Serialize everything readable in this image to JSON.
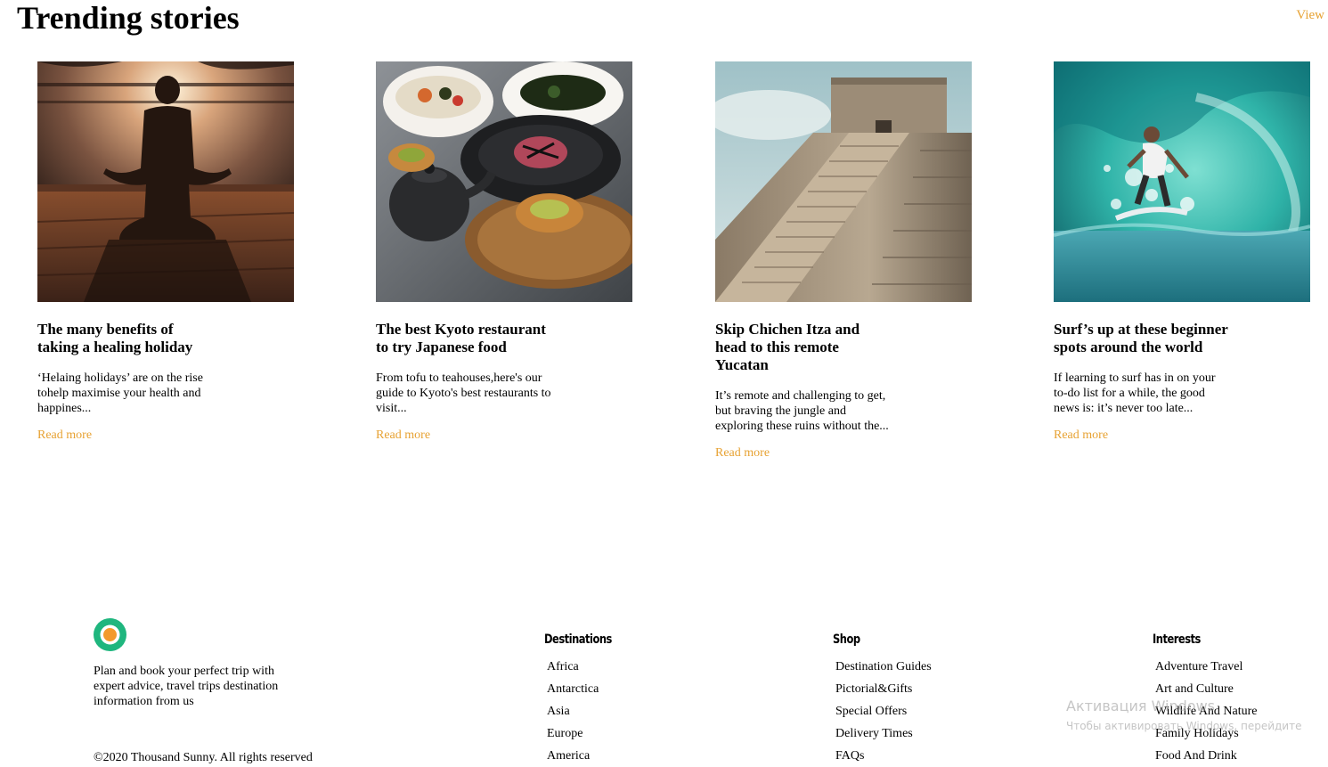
{
  "section": {
    "title": "Trending stories",
    "view_label": "View"
  },
  "accent_color": "#e7a233",
  "cards": [
    {
      "image": "yoga-meditation-photo",
      "title": "The many benefits of taking a healing holiday",
      "excerpt": "‘Helaing holidays’ are on the rise tohelp maximise your health and happines...",
      "link": "Read more"
    },
    {
      "image": "kyoto-food-photo",
      "title": "The best Kyoto restaurant to try Japanese food",
      "excerpt": "From tofu to teahouses,here's our guide to Kyoto's best restaurants to visit...",
      "link": "Read more"
    },
    {
      "image": "chichen-itza-pyramid-photo",
      "title": "Skip Chichen Itza and head to this remote Yucatan",
      "excerpt": "It’s remote and challenging to get, but braving the jungle and exploring these ruins without the...",
      "link": "Read more"
    },
    {
      "image": "surfer-wave-photo",
      "title": "Surf’s up at these beginner spots around the world",
      "excerpt": "If learning to surf has in on your to-do list for a while, the good news is: it’s never too late...",
      "link": "Read more"
    }
  ],
  "footer": {
    "tagline": "Plan and book your perfect trip with expert advice, travel trips destination information from us",
    "copyright": "©2020 Thousand Sunny. All rights reserved",
    "logo_colors": {
      "ring": "#1fb67e",
      "dot": "#f39a2b"
    },
    "columns": [
      {
        "heading": "Destinations",
        "items": [
          "Africa",
          "Antarctica",
          "Asia",
          "Europe",
          "America"
        ]
      },
      {
        "heading": "Shop",
        "items": [
          "Destination Guides",
          "Pictorial&Gifts",
          "Special Offers",
          "Delivery Times",
          "FAQs"
        ]
      },
      {
        "heading": "Interests",
        "items": [
          "Adventure Travel",
          "Art and Culture",
          "Wildlife And Nature",
          "Family Holidays",
          "Food And Drink"
        ]
      }
    ]
  },
  "watermark": {
    "title": "Активация Windows",
    "subtitle": "Чтобы активировать Windows, перейдите"
  }
}
